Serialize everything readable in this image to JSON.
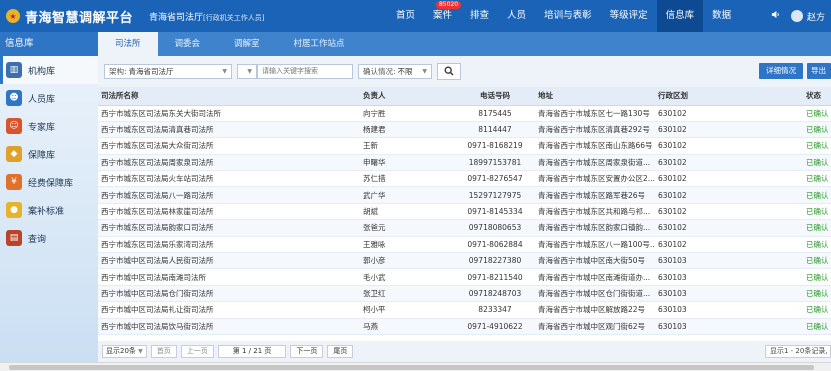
{
  "header": {
    "app_title": "青海智慧调解平台",
    "org_name": "青海省司法厅",
    "org_type": "[行政机关工作人员]",
    "nav": [
      {
        "label": "首页"
      },
      {
        "label": "案件",
        "badge": "85020"
      },
      {
        "label": "排查"
      },
      {
        "label": "人员"
      },
      {
        "label": "培训与表彰"
      },
      {
        "label": "等级评定"
      },
      {
        "label": "信息库"
      },
      {
        "label": "数据"
      }
    ],
    "user_name": "赵方",
    "colors": {
      "bar": "#1a63b6",
      "active": "#0d4a92",
      "badge": "#e33333"
    }
  },
  "sidebar": {
    "title": "信息库",
    "items": [
      {
        "label": "机构库",
        "icon": "building-icon",
        "color": "#3d6fb0"
      },
      {
        "label": "人员库",
        "icon": "people-icon",
        "color": "#2f75c6"
      },
      {
        "label": "专家库",
        "icon": "expert-icon",
        "color": "#d9532c"
      },
      {
        "label": "保障库",
        "icon": "shield-icon",
        "color": "#e0a12a"
      },
      {
        "label": "经费保障库",
        "icon": "money-icon",
        "color": "#e0712a"
      },
      {
        "label": "案补标准",
        "icon": "coin-icon",
        "color": "#e6b32a"
      },
      {
        "label": "查询",
        "icon": "query-icon",
        "color": "#b8452a"
      }
    ]
  },
  "tabs": [
    {
      "label": "司法所"
    },
    {
      "label": "调委会"
    },
    {
      "label": "调解室"
    },
    {
      "label": "村居工作站点"
    }
  ],
  "filters": {
    "org_label": "架构:",
    "org_value": "青海省司法厅",
    "search_placeholder": "请输入关键字搜索",
    "confirm_label": "确认情况:",
    "confirm_value": "不限",
    "detail_button": "详细情况",
    "export_button": "导出"
  },
  "table": {
    "headers": [
      "司法所名称",
      "负责人",
      "电话号码",
      "地址",
      "行政区划",
      "状态"
    ],
    "rows": [
      [
        "西宁市城东区司法局东关大街司法所",
        "向宁胜",
        "8175445",
        "青海省西宁市城东区七一路130号",
        "630102",
        "已确认"
      ],
      [
        "西宁市城东区司法局清真巷司法所",
        "杨建君",
        "8114447",
        "青海省西宁市城东区清真巷292号",
        "630102",
        "已确认"
      ],
      [
        "西宁市城东区司法局大众街司法所",
        "王新",
        "0971-8168219",
        "青海省西宁市城东区南山东路66号",
        "630102",
        "已确认"
      ],
      [
        "西宁市城东区司法局周家泉司法所",
        "申曙华",
        "18997153781",
        "青海省西宁市城东区周家泉街道...",
        "630102",
        "已确认"
      ],
      [
        "西宁市城东区司法局火车站司法所",
        "苏仁措",
        "0971-8276547",
        "青海省西宁市城东区安置办公区2...",
        "630102",
        "已确认"
      ],
      [
        "西宁市城东区司法局八一路司法所",
        "武广华",
        "15297127975",
        "青海省西宁市城东区路军巷26号",
        "630102",
        "已确认"
      ],
      [
        "西宁市城东区司法局林家崖司法所",
        "胡斌",
        "0971-8145334",
        "青海省西宁市城东区共和路与祁...",
        "630102",
        "已确认"
      ],
      [
        "西宁市城东区司法局韵家口司法所",
        "张爸元",
        "09718080653",
        "青海省西宁市城东区韵家口镇韵...",
        "630102",
        "已确认"
      ],
      [
        "西宁市城东区司法局乐家湾司法所",
        "王雅咏",
        "0971-8062884",
        "青海省西宁市城东区八一路100号...",
        "630102",
        "已确认"
      ],
      [
        "西宁市城中区司法局人民街司法所",
        "郭小彦",
        "09718227380",
        "青海省西宁市城中区南大街50号",
        "630103",
        "已确认"
      ],
      [
        "西宁市城中区司法局南滩司法所",
        "毛小武",
        "0971-8211540",
        "青海省西宁市城中区南滩街道办...",
        "630103",
        "已确认"
      ],
      [
        "西宁市城中区司法局仓门街司法所",
        "张卫红",
        "09718248703",
        "青海省西宁市城中区仓门街街道...",
        "630103",
        "已确认"
      ],
      [
        "西宁市城中区司法局礼让街司法所",
        "柯小平",
        "8233347",
        "青海省西宁市城中区解放路22号",
        "630103",
        "已确认"
      ],
      [
        "西宁市城中区司法局饮马街司法所",
        "马燕",
        "0971-4910622",
        "青海省西宁市城中区观门街62号",
        "630103",
        "已确认"
      ]
    ]
  },
  "pager": {
    "page_size": "显示20条",
    "first": "首页",
    "prev": "上一页",
    "page_info": "第 1 / 21 页",
    "next": "下一页",
    "last": "尾页",
    "range_info": "显示1 - 20条记录,"
  }
}
